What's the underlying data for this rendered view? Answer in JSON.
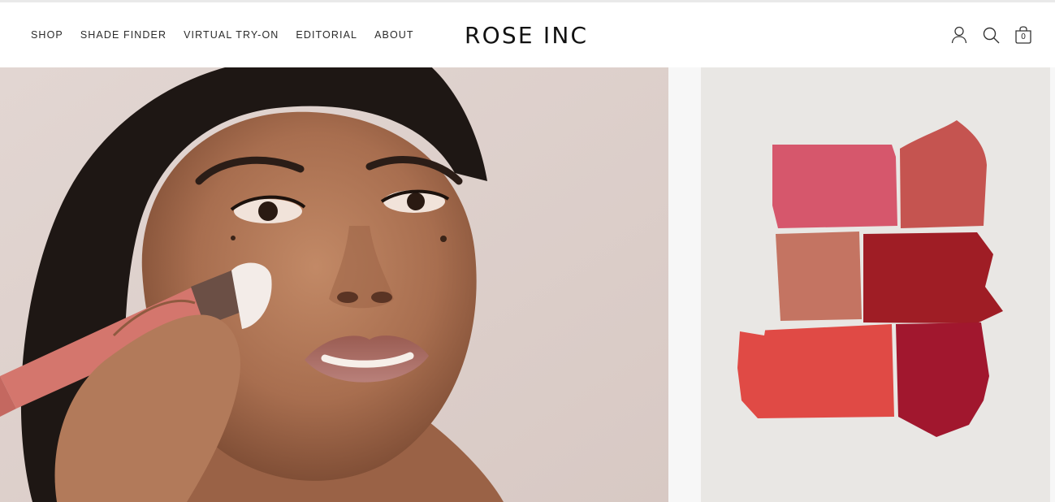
{
  "brand": {
    "name": "ROSE INC"
  },
  "nav": {
    "items": [
      {
        "label": "SHOP"
      },
      {
        "label": "SHADE FINDER"
      },
      {
        "label": "VIRTUAL TRY-ON"
      },
      {
        "label": "EDITORIAL"
      },
      {
        "label": "ABOUT"
      }
    ]
  },
  "header_icons": {
    "account": "user-icon",
    "search": "search-icon",
    "bag": "shopping-bag-icon",
    "bag_count": "0"
  },
  "hero": {
    "left_image": "model-applying-blush-photo",
    "right_image": "lip-color-swatches-photo"
  },
  "colors": {
    "background": "#ffffff",
    "text": "#1a1a1a",
    "hero_left_bg": "#ddd0cc",
    "hero_right_bg": "#e9e7e4"
  }
}
